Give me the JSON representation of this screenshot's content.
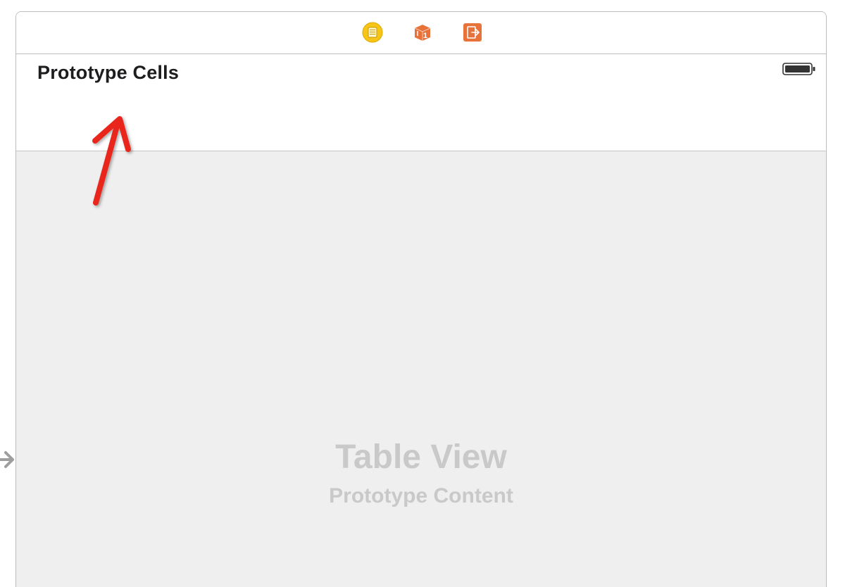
{
  "toolbar": {
    "icons": [
      "view-controller-icon",
      "first-responder-icon",
      "exit-icon"
    ],
    "first_responder_number": "1"
  },
  "header": {
    "title": "Prototype Cells"
  },
  "status_bar": {
    "battery_icon": "battery-icon"
  },
  "table_view": {
    "placeholder_title": "Table View",
    "placeholder_subtitle": "Prototype Content"
  },
  "annotation": {
    "arrow_color": "#e8271c"
  },
  "colors": {
    "view_controller_icon": "#f5c518",
    "first_responder_icon": "#e8733a",
    "exit_icon": "#e8733a",
    "table_background": "#efefef",
    "placeholder_text": "#c9c9c9"
  }
}
